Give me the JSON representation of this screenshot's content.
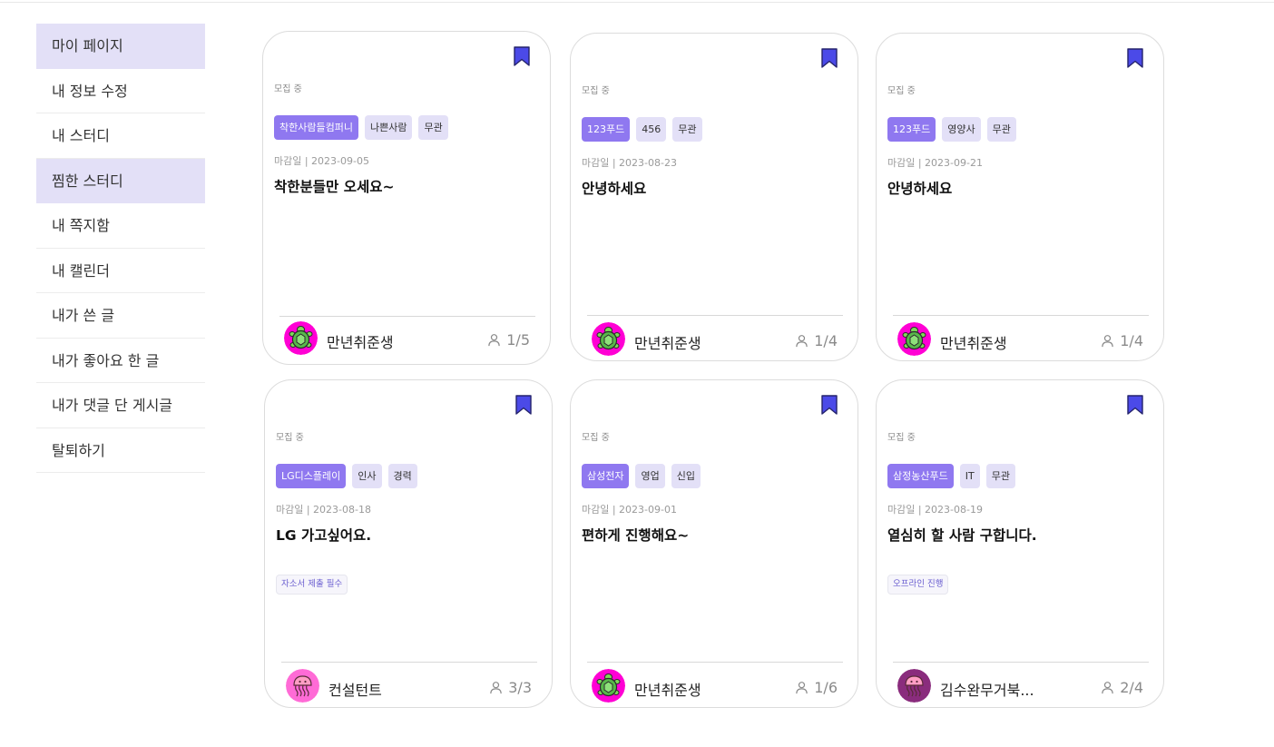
{
  "sidebar": {
    "items": [
      {
        "label": "마이 페이지",
        "active": true
      },
      {
        "label": "내 정보 수정",
        "active": false
      },
      {
        "label": "내 스터디",
        "active": false
      },
      {
        "label": "찜한 스터디",
        "active": true
      },
      {
        "label": "내 쪽지함",
        "active": false
      },
      {
        "label": "내 캘린더",
        "active": false
      },
      {
        "label": "내가 쓴 글",
        "active": false
      },
      {
        "label": "내가 좋아요 한 글",
        "active": false
      },
      {
        "label": "내가 댓글 단 게시글",
        "active": false
      },
      {
        "label": "탈퇴하기",
        "active": false
      }
    ]
  },
  "colors": {
    "accent": "#8f78f0",
    "tag_bg": "#e3e0f7",
    "bookmark": "#4b4ae8",
    "avatar_turtle_bg": "#ff00d4",
    "avatar_jelly_bg": "#ff6bd6",
    "avatar_jelly_dark_bg": "#8a2c7d"
  },
  "cards": [
    {
      "status": "모집 중",
      "tags": [
        "착한사람들컴퍼니",
        "나쁜사람",
        "무관"
      ],
      "deadline": "마감일 | 2023-09-05",
      "title": "착한분들만 오세요~",
      "note": "",
      "author": "만년취준생",
      "avatar_icon": "turtle-avatar",
      "members": "1/5"
    },
    {
      "status": "모집 중",
      "tags": [
        "123푸드",
        "456",
        "무관"
      ],
      "deadline": "마감일 | 2023-08-23",
      "title": "안녕하세요",
      "note": "",
      "author": "만년취준생",
      "avatar_icon": "turtle-avatar",
      "members": "1/4"
    },
    {
      "status": "모집 중",
      "tags": [
        "123푸드",
        "영양사",
        "무관"
      ],
      "deadline": "마감일 | 2023-09-21",
      "title": "안녕하세요",
      "note": "",
      "author": "만년취준생",
      "avatar_icon": "turtle-avatar",
      "members": "1/4"
    },
    {
      "status": "모집 중",
      "tags": [
        "LG디스플레이",
        "인사",
        "경력"
      ],
      "deadline": "마감일 | 2023-08-18",
      "title": "LG 가고싶어요.",
      "note": "자소서 제출 필수",
      "author": "컨설턴트",
      "avatar_icon": "jellyfish-avatar",
      "members": "3/3"
    },
    {
      "status": "모집 중",
      "tags": [
        "삼성전자",
        "영업",
        "신입"
      ],
      "deadline": "마감일 | 2023-09-01",
      "title": "편하게 진행해요~",
      "note": "",
      "author": "만년취준생",
      "avatar_icon": "turtle-avatar",
      "members": "1/6"
    },
    {
      "status": "모집 중",
      "tags": [
        "삼정농산푸드",
        "IT",
        "무관"
      ],
      "deadline": "마감일 | 2023-08-19",
      "title": "열심히 할 사람 구합니다.",
      "note": "오프라인 진행",
      "author": "김수완무거북...",
      "avatar_icon": "jellyfish-dark-avatar",
      "members": "2/4"
    }
  ]
}
